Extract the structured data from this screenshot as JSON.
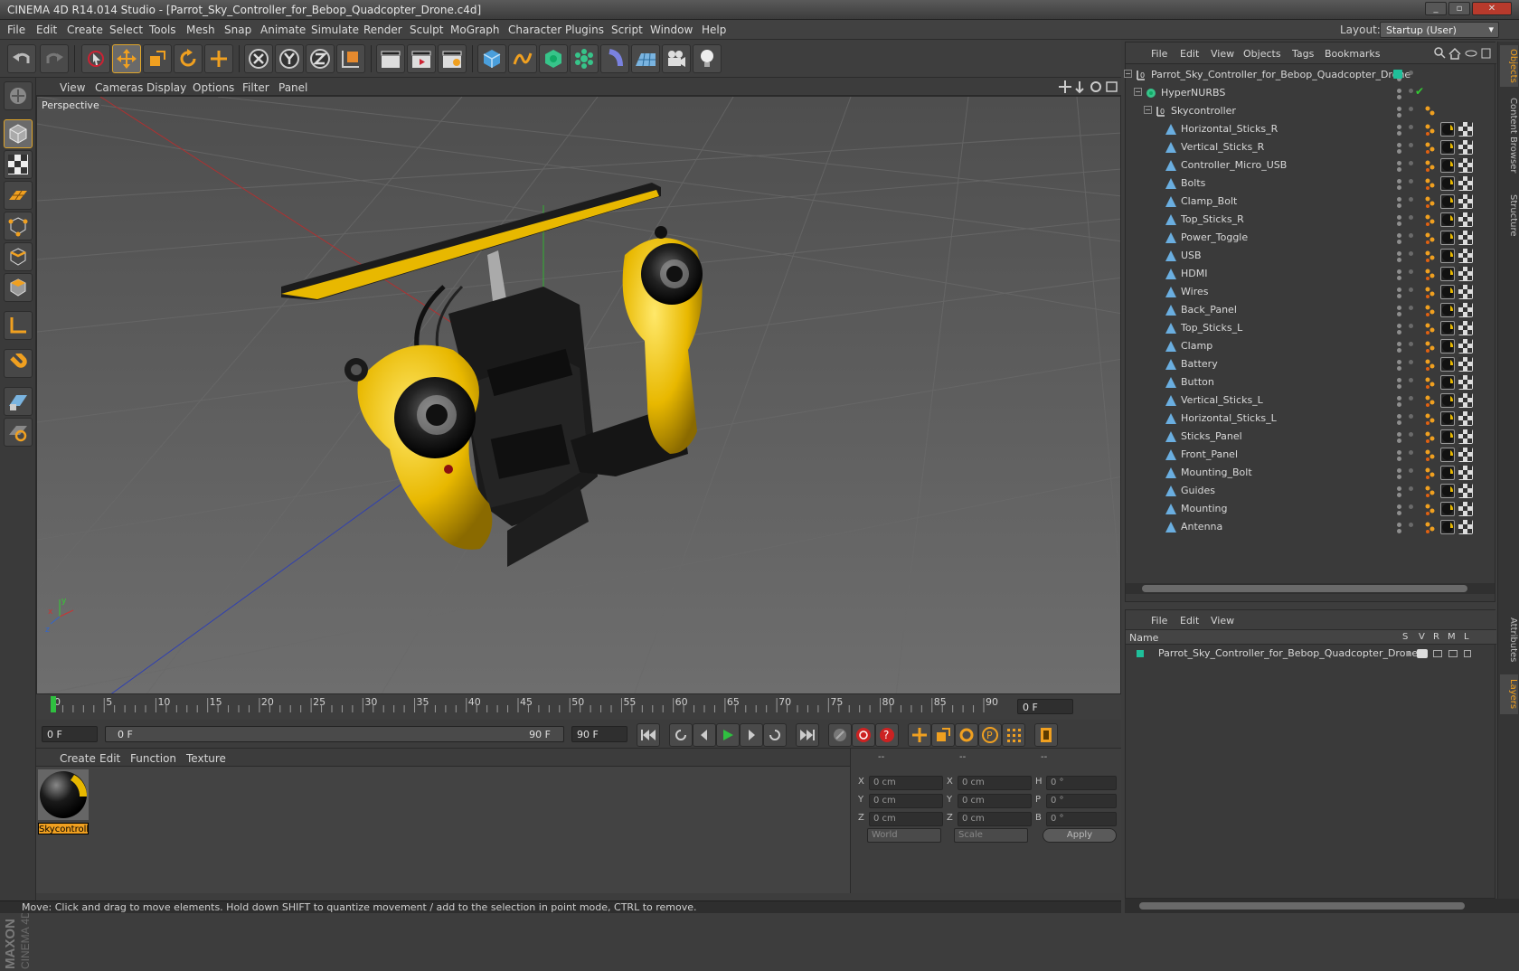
{
  "window": {
    "title": "CINEMA 4D R14.014 Studio - [Parrot_Sky_Controller_for_Bebop_Quadcopter_Drone.c4d]",
    "btn_min": "_",
    "btn_max": "▫",
    "btn_close": "✕"
  },
  "menu": {
    "items": [
      "File",
      "Edit",
      "Create",
      "Select",
      "Tools",
      "Mesh",
      "Snap",
      "Animate",
      "Simulate",
      "Render",
      "Sculpt",
      "MoGraph",
      "Character",
      "Plugins",
      "Script",
      "Window",
      "Help"
    ],
    "layout_label": "Layout:",
    "layout_value": "Startup (User)"
  },
  "viewport": {
    "menu": [
      "View",
      "Cameras",
      "Display",
      "Options",
      "Filter",
      "Panel"
    ],
    "label": "Perspective",
    "axis_x": "x",
    "axis_y": "y",
    "axis_z": "z"
  },
  "timeline": {
    "ticks": [
      "0",
      "5",
      "10",
      "15",
      "20",
      "25",
      "30",
      "35",
      "40",
      "45",
      "50",
      "55",
      "60",
      "65",
      "70",
      "75",
      "80",
      "85",
      "90"
    ],
    "current_frame": "0 F",
    "start_field": "0 F",
    "range_start": "0 F",
    "range_end": "90 F",
    "end_field": "90 F"
  },
  "materials": {
    "menu": [
      "Create",
      "Edit",
      "Function",
      "Texture"
    ],
    "items": [
      {
        "name": "Skycontroll"
      }
    ]
  },
  "coords": {
    "headers": [
      "--",
      "--",
      "--"
    ],
    "rows": [
      {
        "a": "X",
        "av": "0 cm",
        "b": "X",
        "bv": "0 cm",
        "c": "H",
        "cv": "0 °"
      },
      {
        "a": "Y",
        "av": "0 cm",
        "b": "Y",
        "bv": "0 cm",
        "c": "P",
        "cv": "0 °"
      },
      {
        "a": "Z",
        "av": "0 cm",
        "b": "Z",
        "bv": "0 cm",
        "c": "B",
        "cv": "0 °"
      }
    ],
    "world": "World",
    "scale": "Scale",
    "apply": "Apply"
  },
  "status": "Move: Click and drag to move elements. Hold down SHIFT to quantize movement / add to the selection in point mode, CTRL to remove.",
  "objects": {
    "menu": [
      "File",
      "Edit",
      "View",
      "Objects",
      "Tags",
      "Bookmarks"
    ],
    "root": "Parrot_Sky_Controller_for_Bebop_Quadcopter_Drone",
    "hypernurbs": "HyperNURBS",
    "group": "Skycontroller",
    "children": [
      "Horizontal_Sticks_R",
      "Vertical_Sticks_R",
      "Controller_Micro_USB",
      "Bolts",
      "Clamp_Bolt",
      "Top_Sticks_R",
      "Power_Toggle",
      "USB",
      "HDMI",
      "Wires",
      "Back_Panel",
      "Top_Sticks_L",
      "Clamp",
      "Battery",
      "Button",
      "Vertical_Sticks_L",
      "Horizontal_Sticks_L",
      "Sticks_Panel",
      "Front_Panel",
      "Mounting_Bolt",
      "Guides",
      "Mounting",
      "Antenna"
    ]
  },
  "layers": {
    "menu": [
      "File",
      "Edit",
      "View"
    ],
    "col_name": "Name",
    "cols": [
      "S",
      "V",
      "R",
      "M",
      "L"
    ],
    "items": [
      "Parrot_Sky_Controller_for_Bebop_Quadcopter_Drone"
    ]
  },
  "side_tabs": [
    "Objects",
    "Content Browser",
    "Structure",
    "Attributes",
    "Layers"
  ],
  "brand": {
    "maxon": "MAXON",
    "c4d": "CINEMA 4D"
  },
  "colors": {
    "accent": "#e0a62a",
    "selected_text": "#f0a020",
    "layer_color": "#1fbf9a"
  }
}
